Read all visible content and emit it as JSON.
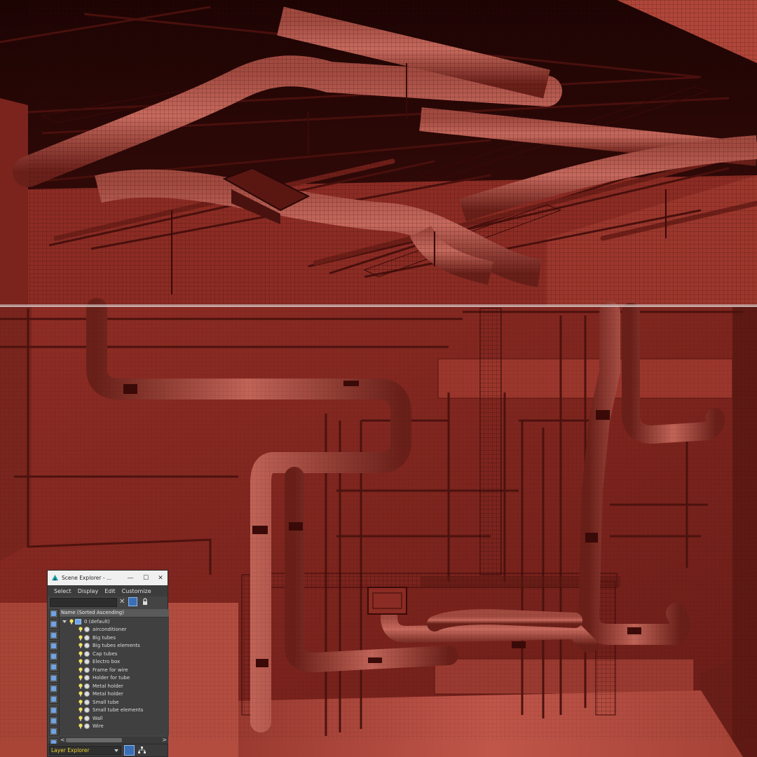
{
  "window": {
    "title": "Scene Explorer - ...",
    "minimize_label": "—",
    "maximize_label": "☐",
    "close_label": "✕"
  },
  "menu": {
    "items": [
      "Select",
      "Display",
      "Edit",
      "Customize"
    ]
  },
  "toolbar": {
    "filter_value": "",
    "clear_label": "✕"
  },
  "tree": {
    "column_header": "Name (Sorted Ascending)",
    "root_label": "0 (default)",
    "layers": [
      "airconditioner",
      "Big tubes",
      "Big tubes elements",
      "Cap tubes",
      "Electro box",
      "Frame for wire",
      "Holder for tube",
      "Metal  holder",
      "Metal holder",
      "Small tube",
      "Small tube elements",
      "Wall",
      "Wire"
    ]
  },
  "scroll": {
    "left_arrow": "<",
    "right_arrow": ">"
  },
  "bottom": {
    "explorer_mode": "Layer Explorer"
  },
  "colors": {
    "scene_wall": "#8a2a22",
    "scene_ceiling_void": "#1f0504",
    "scene_floor": "#b84a3c",
    "panel_bg": "#444444",
    "highlight_blue": "#3a6fb5",
    "mode_text": "#f0d22e"
  }
}
